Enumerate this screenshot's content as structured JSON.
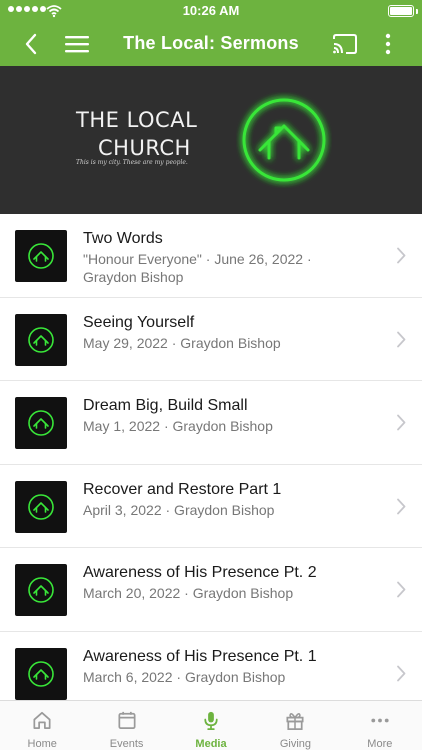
{
  "status_bar": {
    "time": "10:26 AM"
  },
  "nav": {
    "title": "The Local: Sermons",
    "icons": [
      "back-arrow-icon",
      "menu-icon",
      "cast-icon",
      "more-vertical-icon"
    ]
  },
  "banner": {
    "line1": "THE LOCAL",
    "line2": "CHURCH",
    "tagline": "This is my city. These are my people."
  },
  "sermons": [
    {
      "title": "Two Words",
      "line1": "\"Honour Everyone\" · June 26, 2022 ·",
      "line2": "Graydon Bishop"
    },
    {
      "title": "Seeing Yourself",
      "line1": "May 29, 2022 · Graydon Bishop",
      "line2": ""
    },
    {
      "title": "Dream Big, Build Small",
      "line1": "May 1, 2022 · Graydon Bishop",
      "line2": ""
    },
    {
      "title": "Recover and Restore Part 1",
      "line1": "April 3, 2022 · Graydon Bishop",
      "line2": ""
    },
    {
      "title": "Awareness of His Presence Pt. 2",
      "line1": "March 20, 2022 · Graydon Bishop",
      "line2": ""
    },
    {
      "title": "Awareness of His Presence Pt. 1",
      "line1": "March 6, 2022 · Graydon Bishop",
      "line2": ""
    }
  ],
  "tabs": [
    {
      "label": "Home",
      "icon": "home-icon"
    },
    {
      "label": "Events",
      "icon": "calendar-icon"
    },
    {
      "label": "Media",
      "icon": "microphone-icon"
    },
    {
      "label": "Giving",
      "icon": "gift-icon"
    },
    {
      "label": "More",
      "icon": "more-horizontal-icon"
    }
  ],
  "active_tab": "Media",
  "colors": {
    "brand_green": "#6db33f",
    "neon_green": "#39e639",
    "banner_bg": "#2f2f2f"
  }
}
